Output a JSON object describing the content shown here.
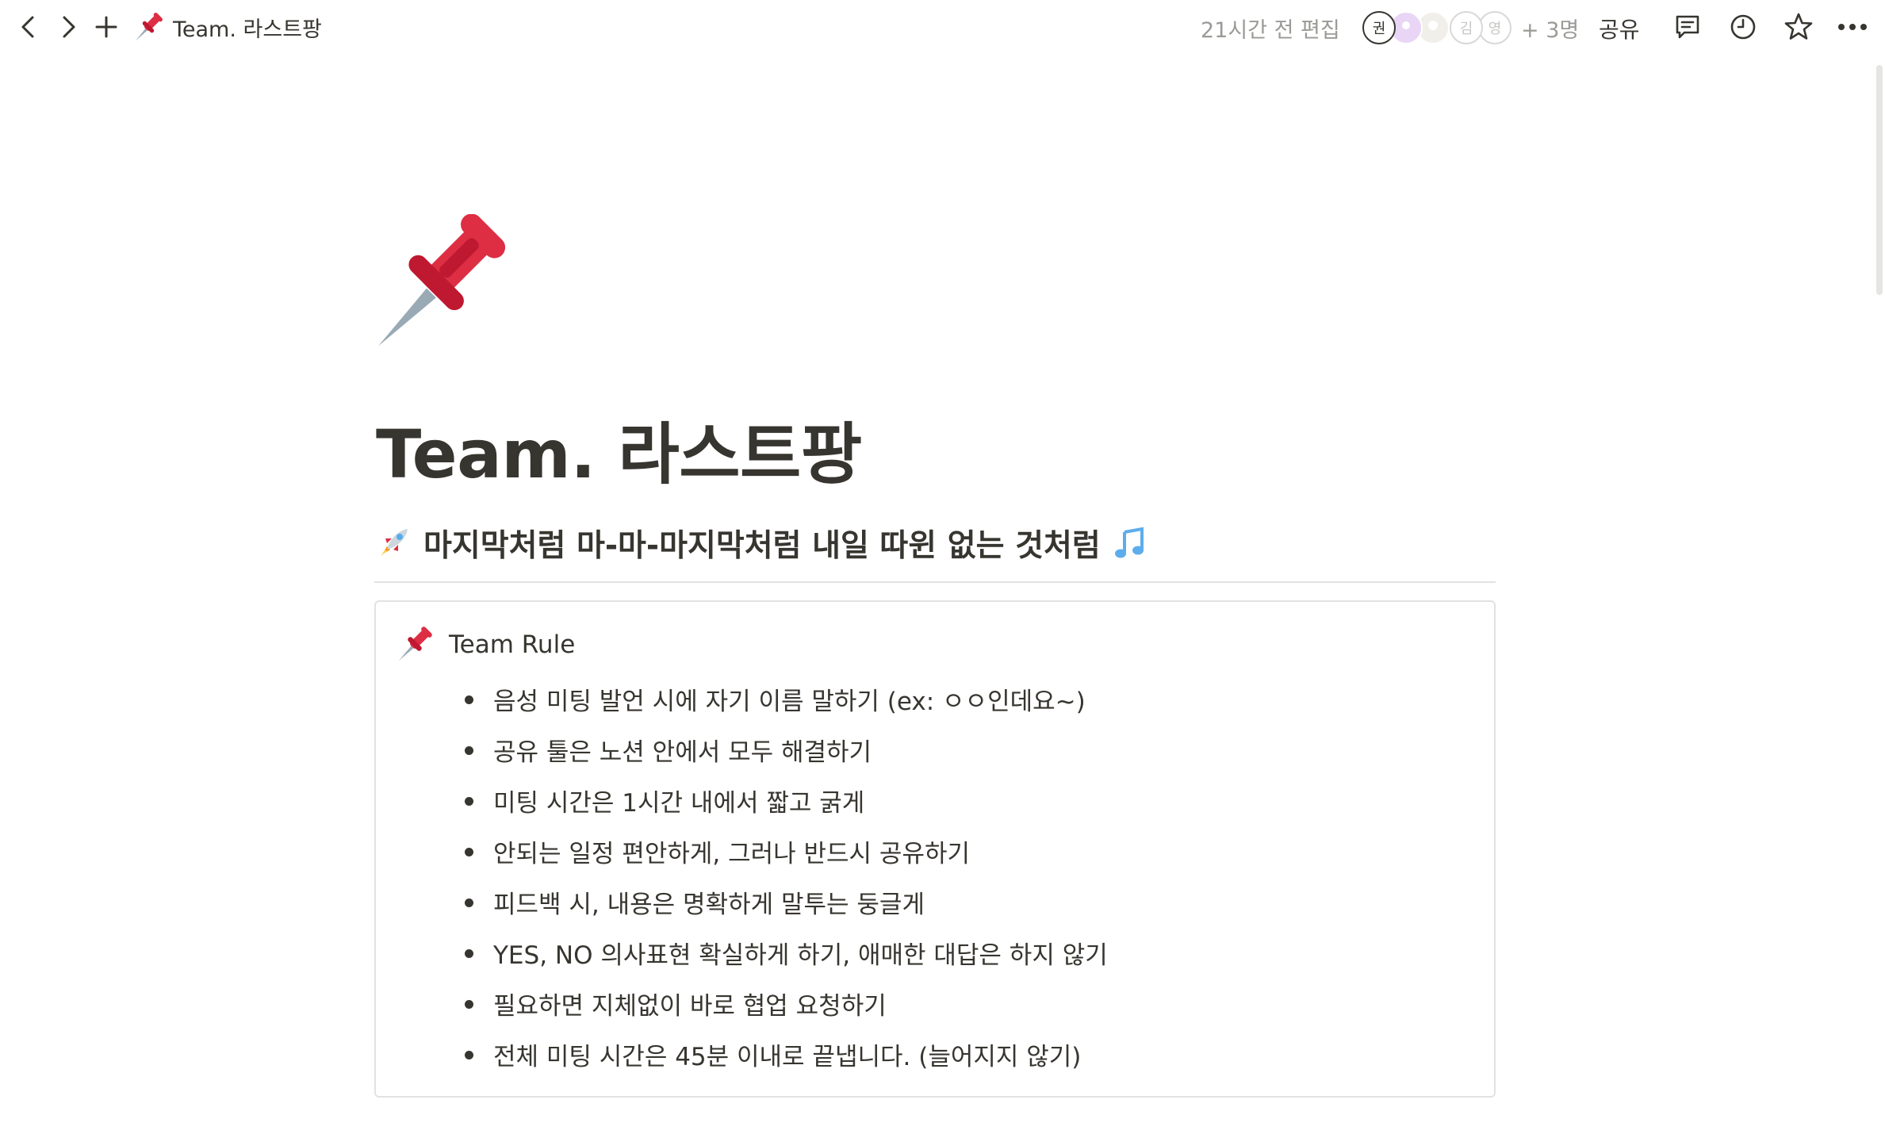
{
  "topbar": {
    "breadcrumb_title": "Team. 라스트팡",
    "edited_text": "21시간 전 편집",
    "avatars": [
      {
        "label": "권",
        "color": "#ffffff",
        "text_color": "#37352f",
        "border": "#37352f"
      },
      {
        "label": "",
        "color": "#e9d5f5",
        "text_color": "#ffffff",
        "border": "#ffffff"
      },
      {
        "label": "",
        "color": "#f1efe9",
        "text_color": "#ffffff",
        "border": "#ffffff"
      },
      {
        "label": "김",
        "color": "#ffffff",
        "text_color": "#c7c6c4",
        "border": "#d9d8d6"
      },
      {
        "label": "영",
        "color": "#ffffff",
        "text_color": "#c7c6c4",
        "border": "#d9d8d6"
      }
    ],
    "more_members": "+ 3명",
    "share_label": "공유",
    "icons": [
      "back-icon",
      "forward-icon",
      "plus-icon",
      "comment-icon",
      "history-icon",
      "star-icon",
      "more-icon"
    ]
  },
  "page": {
    "icon": "pushpin-icon",
    "title": "Team. 라스트팡",
    "heading": {
      "leading_icon": "rocket-icon",
      "text": "마지막처럼 마-마-마지막처럼 내일 따윈 없는 것처럼",
      "trailing_icon": "music-note-icon"
    },
    "callout": {
      "icon": "pushpin-icon",
      "title": "Team Rule",
      "rules": [
        "음성 미팅 발언 시에 자기 이름 말하기 (ex: ㅇㅇ인데요~)",
        "공유 툴은 노션 안에서 모두 해결하기",
        "미팅 시간은 1시간 내에서 짧고 굵게",
        "안되는 일정 편안하게, 그러나 반드시 공유하기",
        "피드백 시, 내용은 명확하게 말투는 둥글게",
        "YES, NO 의사표현 확실하게 하기, 애매한 대답은 하지 않기",
        "필요하면 지체없이 바로 협업 요청하기",
        "전체 미팅 시간은 45분 이내로 끝냅니다. (늘어지지 않기)"
      ]
    }
  },
  "colors": {
    "text": "#37352f",
    "muted": "#9b9a97",
    "border": "#e3e2e0",
    "pin_red": "#dd2e44",
    "music_blue": "#5dadec"
  }
}
